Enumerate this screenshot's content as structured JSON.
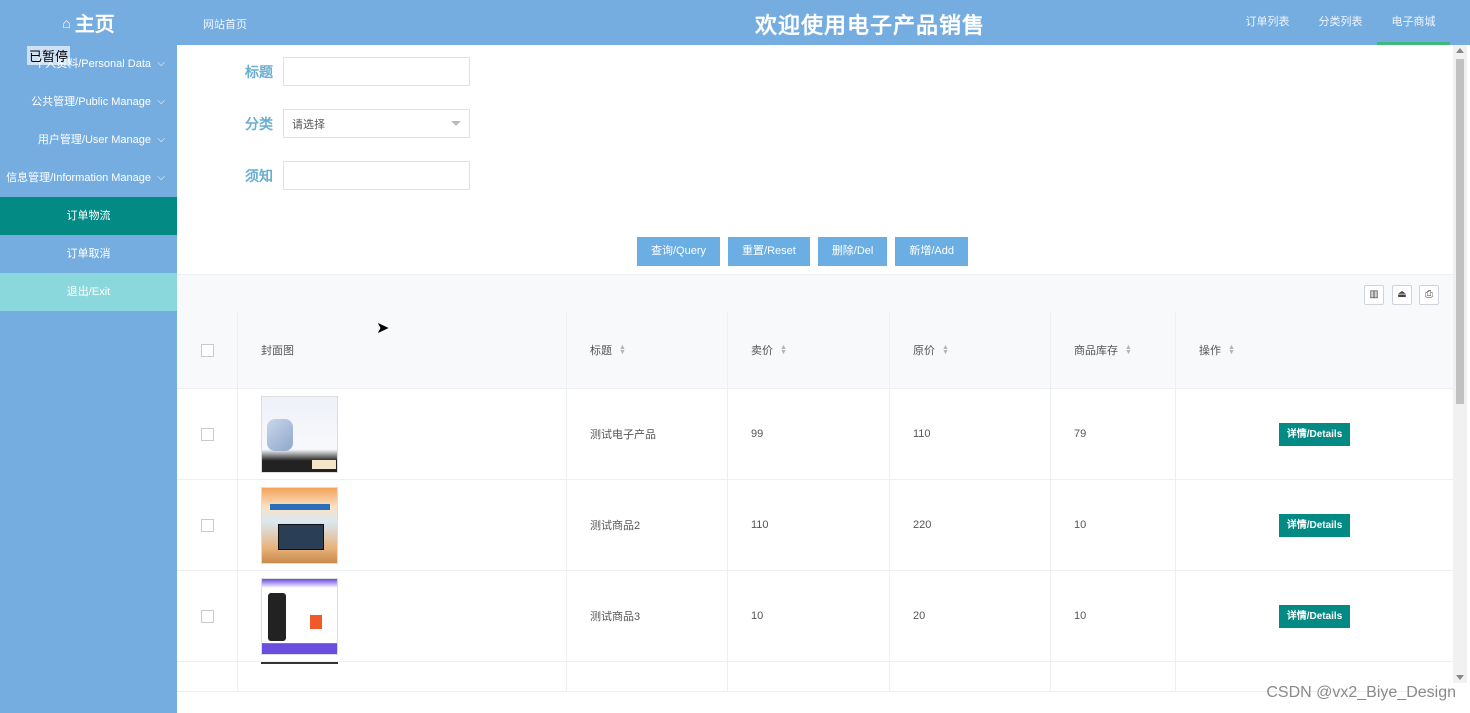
{
  "header": {
    "logo": "主页",
    "site_link": "网站首页",
    "title": "欢迎使用电子产品销售",
    "nav": [
      "订单列表",
      "分类列表",
      "电子商城"
    ]
  },
  "overlay": {
    "paused": "已暂停"
  },
  "sidebar": {
    "items": [
      {
        "label": "个人资料/Personal Data"
      },
      {
        "label": "公共管理/Public Manage"
      },
      {
        "label": "用户管理/User Manage"
      },
      {
        "label": "信息管理/Information Manage"
      },
      {
        "label": "订单物流"
      },
      {
        "label": "订单取消"
      },
      {
        "label": "退出/Exit"
      }
    ]
  },
  "form": {
    "title_label": "标题",
    "title_value": "",
    "category_label": "分类",
    "category_value": "请选择",
    "notice_label": "须知",
    "notice_value": ""
  },
  "buttons": {
    "query": "查询/Query",
    "reset": "重置/Reset",
    "delete": "删除/Del",
    "add": "新增/Add"
  },
  "toolbar": {
    "icons": [
      "columns-icon",
      "export-icon",
      "print-icon"
    ]
  },
  "table": {
    "headers": [
      "封面图",
      "标题",
      "卖价",
      "原价",
      "商品库存",
      "操作"
    ],
    "rows": [
      {
        "title": "测试电子产品",
        "price": "99",
        "orig": "110",
        "stock": "79",
        "action": "详情/Details"
      },
      {
        "title": "测试商品2",
        "price": "110",
        "orig": "220",
        "stock": "10",
        "action": "详情/Details"
      },
      {
        "title": "测试商品3",
        "price": "10",
        "orig": "20",
        "stock": "10",
        "action": "详情/Details"
      }
    ]
  },
  "watermark": "CSDN @vx2_Biye_Design",
  "colors": {
    "header": "#76ade1",
    "active": "#048a85",
    "exit": "#8bd8dc",
    "button": "#6aaee4"
  }
}
